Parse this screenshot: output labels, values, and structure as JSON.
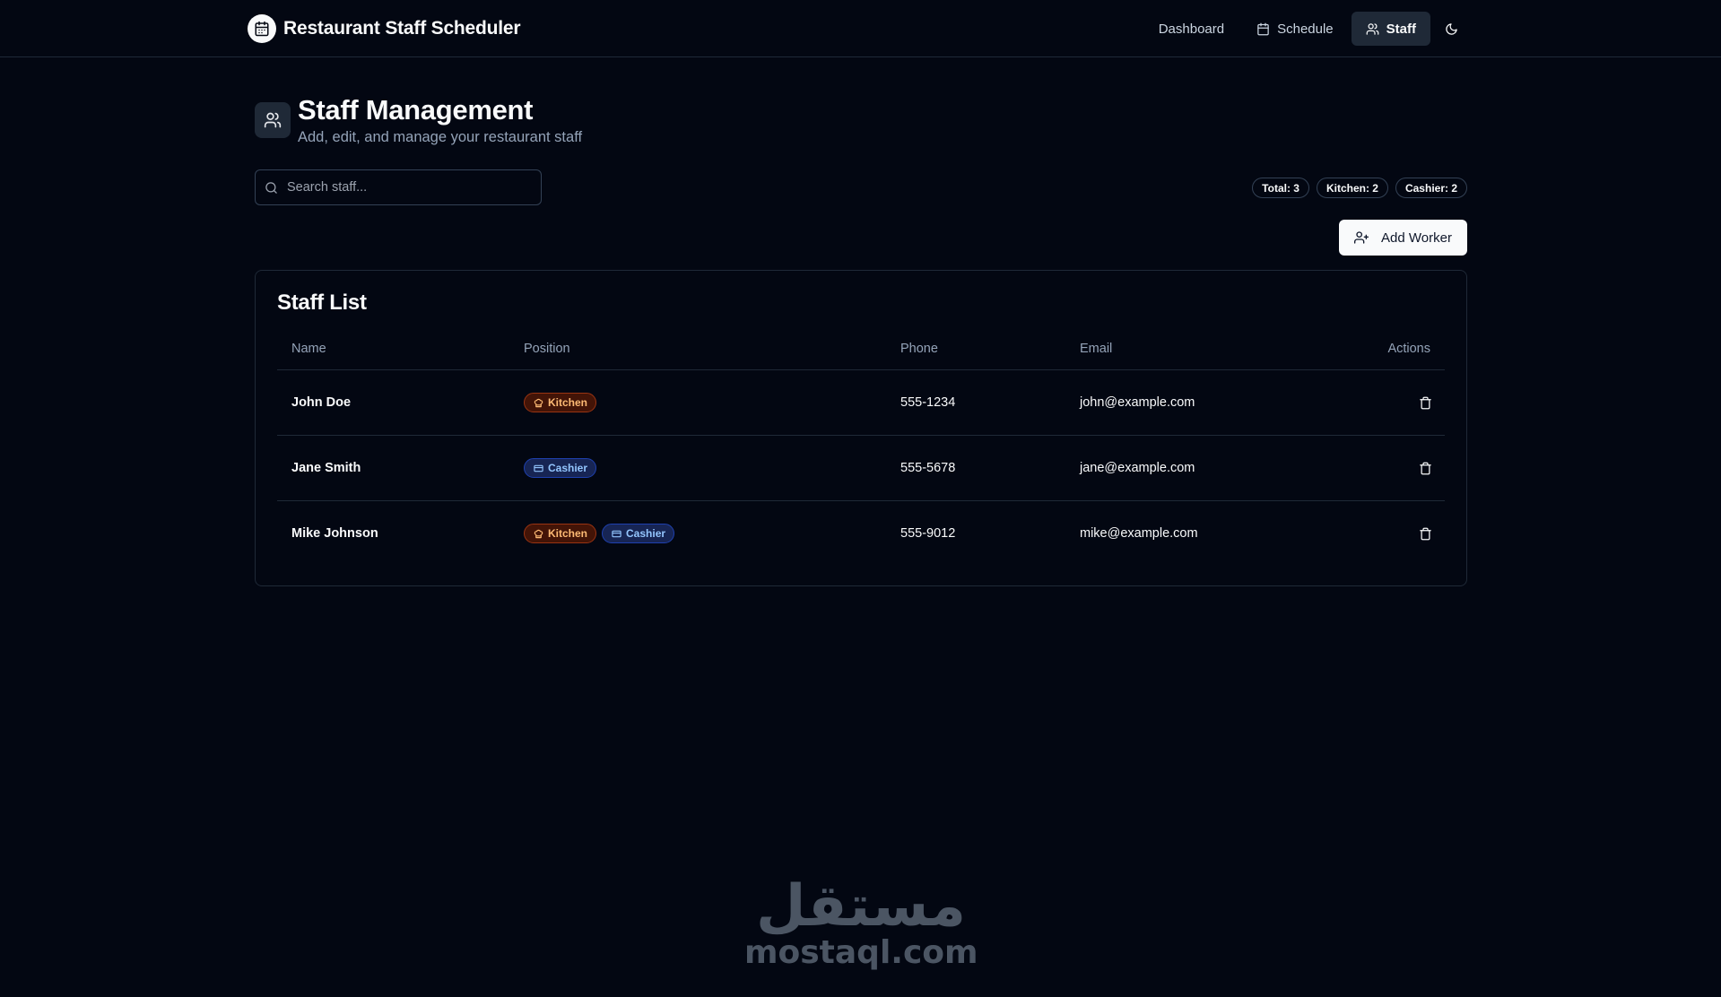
{
  "app": {
    "title": "Restaurant Staff Scheduler",
    "logo_icon": "calendar-icon"
  },
  "nav": {
    "items": [
      {
        "label": "Dashboard",
        "icon": "",
        "active": false
      },
      {
        "label": "Schedule",
        "icon": "calendar-icon",
        "active": false
      },
      {
        "label": "Staff",
        "icon": "users-icon",
        "active": true
      }
    ],
    "theme_toggle_icon": "moon-icon"
  },
  "page": {
    "title": "Staff Management",
    "subtitle": "Add, edit, and manage your restaurant staff",
    "icon": "users-icon"
  },
  "search": {
    "placeholder": "Search staff...",
    "value": ""
  },
  "stats": {
    "total": "Total: 3",
    "kitchen": "Kitchen: 2",
    "cashier": "Cashier: 2"
  },
  "add_button": {
    "label": "Add Worker",
    "icon": "user-plus-icon"
  },
  "staff_list": {
    "title": "Staff List",
    "columns": {
      "name": "Name",
      "position": "Position",
      "phone": "Phone",
      "email": "Email",
      "actions": "Actions"
    },
    "rows": [
      {
        "name": "John Doe",
        "positions": [
          "Kitchen"
        ],
        "phone": "555-1234",
        "email": "john@example.com"
      },
      {
        "name": "Jane Smith",
        "positions": [
          "Cashier"
        ],
        "phone": "555-5678",
        "email": "jane@example.com"
      },
      {
        "name": "Mike Johnson",
        "positions": [
          "Kitchen",
          "Cashier"
        ],
        "phone": "555-9012",
        "email": "mike@example.com"
      }
    ],
    "delete_icon": "trash-icon"
  },
  "watermark": {
    "arabic": "مستقل",
    "latin": "mostaql.com"
  },
  "colors": {
    "background": "#030712",
    "kitchen_badge": "#fdba74",
    "cashier_badge": "#93c5fd"
  }
}
